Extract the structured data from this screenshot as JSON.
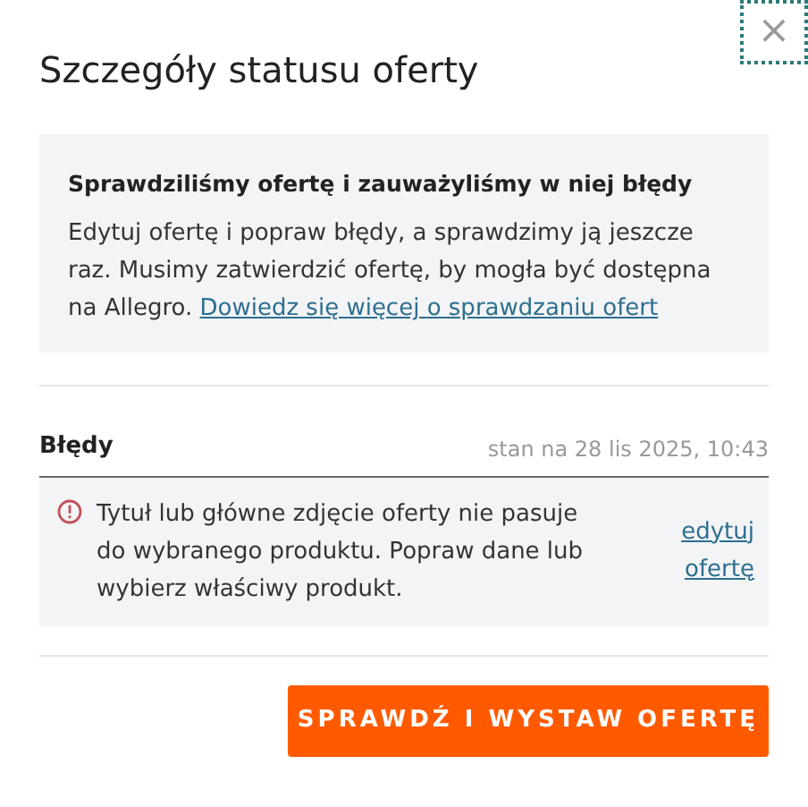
{
  "dialog": {
    "title": "Szczegóły statusu oferty",
    "close_label": "×"
  },
  "notice": {
    "heading": "Sprawdziliśmy ofertę i zauważyliśmy w niej błędy",
    "text": "Edytuj ofertę i popraw błędy, a sprawdzimy ją jeszcze raz. Musimy zatwierdzić ofertę, by mogła być dostępna na Allegro.",
    "link": "Dowiedz się więcej o sprawdzaniu ofert"
  },
  "errors": {
    "heading": "Błędy",
    "timestamp": "stan na 28 lis 2025, 10:43",
    "items": [
      {
        "text": "Tytuł lub główne zdjęcie oferty nie pasuje do wybranego produktu. Popraw dane lub wybierz właściwy produkt.",
        "action": "edytuj ofertę"
      }
    ]
  },
  "primary_button": "SPRAWDŹ I WYSTAW OFERTĘ"
}
